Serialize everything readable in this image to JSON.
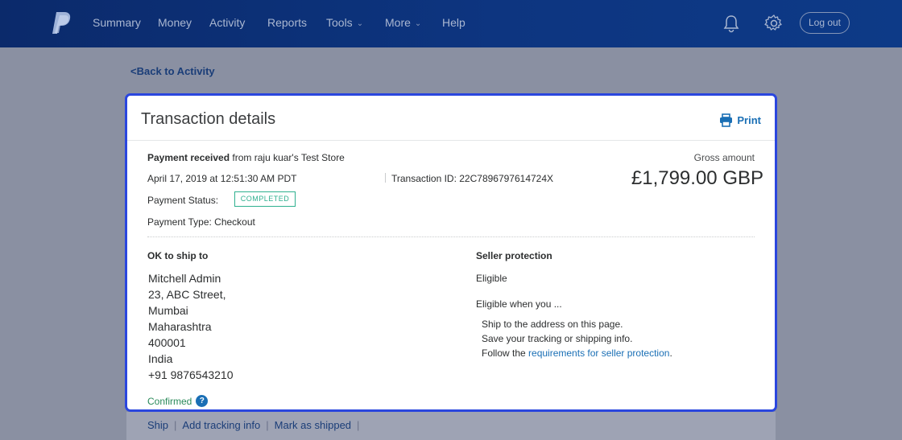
{
  "nav": {
    "items": [
      {
        "label": "Summary",
        "dropdown": false
      },
      {
        "label": "Money",
        "dropdown": false
      },
      {
        "label": "Activity",
        "dropdown": false
      },
      {
        "label": "Reports",
        "dropdown": false
      },
      {
        "label": "Tools",
        "dropdown": true
      },
      {
        "label": "More",
        "dropdown": true
      },
      {
        "label": "Help",
        "dropdown": false
      }
    ],
    "logout_label": "Log out",
    "icons": [
      "paypal-logo",
      "bell-icon",
      "gear-icon"
    ]
  },
  "back_link": "<Back to Activity",
  "card": {
    "title": "Transaction details",
    "print_label": "Print",
    "payment_received_label": "Payment received",
    "from_text": "from raju kuar's Test Store",
    "date": "April 17, 2019 at 12:51:30 AM PDT",
    "transaction_id": "Transaction ID: 22C7896797614724X",
    "status_label": "Payment Status:",
    "status_value": "COMPLETED",
    "payment_type": "Payment Type: Checkout",
    "gross_label": "Gross amount",
    "gross_amount": "£1,799.00 GBP"
  },
  "shipping": {
    "heading": "OK to ship to",
    "address_lines": [
      "Mitchell Admin",
      "23, ABC Street,",
      "Mumbai",
      "Maharashtra",
      "400001",
      "India",
      "+91 9876543210"
    ],
    "confirmed_label": "Confirmed",
    "help_icon": "?"
  },
  "seller_protection": {
    "heading": "Seller protection",
    "status": "Eligible",
    "eligible_when": "Eligible when you ...",
    "bullet_1": "Ship to the address on this page.",
    "bullet_2": "Save your tracking or shipping info.",
    "bullet_3_prefix": "Follow the ",
    "bullet_3_link": "requirements for seller protection",
    "bullet_3_suffix": "."
  },
  "actions": {
    "ship": "Ship",
    "add_tracking": "Add tracking info",
    "mark_shipped": "Mark as shipped",
    "separator": "|"
  },
  "colors": {
    "header_bg": "#0d3580",
    "overlay_bg": "#8a90a2",
    "card_highlight": "#2a46de",
    "status_green": "#2fb08f",
    "link_blue": "#1a6fb5"
  }
}
